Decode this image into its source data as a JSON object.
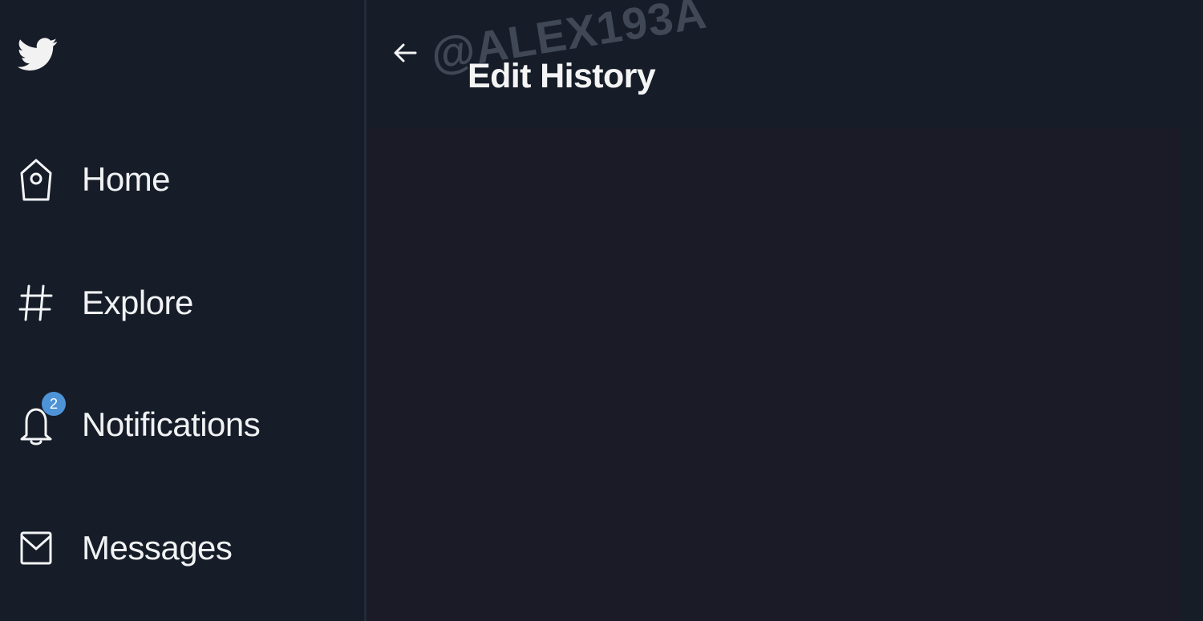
{
  "sidebar": {
    "logo_icon": "twitter-bird-icon",
    "items": [
      {
        "label": "Home",
        "icon": "home-icon"
      },
      {
        "label": "Explore",
        "icon": "hashtag-icon"
      },
      {
        "label": "Notifications",
        "icon": "bell-icon",
        "badge": "2"
      },
      {
        "label": "Messages",
        "icon": "envelope-icon"
      }
    ]
  },
  "header": {
    "back_icon": "arrow-left-icon",
    "title": "Edit History",
    "watermark": "@ALEX193A"
  },
  "colors": {
    "sidebar_bg": "#161d28",
    "header_bg": "#161d29",
    "content_bg": "#1b1b28",
    "text": "#f1f2f4",
    "badge": "#4f93d7"
  }
}
